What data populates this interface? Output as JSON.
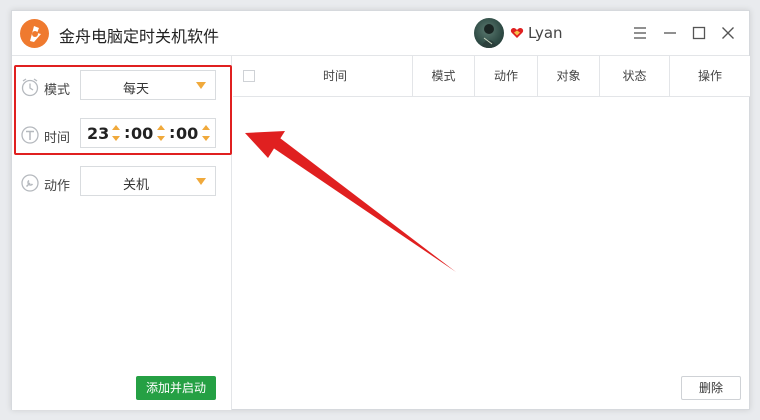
{
  "app": {
    "title": "金舟电脑定时关机软件",
    "accent": "#ef7a2f"
  },
  "user": {
    "name": "Lyan",
    "vip_color": "#e02020"
  },
  "controls": {
    "mode": {
      "label": "模式",
      "value": "每天"
    },
    "time": {
      "label": "时间",
      "hour": "23",
      "minute": "00",
      "second": "00",
      "sep": ":"
    },
    "action": {
      "label": "动作",
      "value": "关机"
    },
    "add_button": "添加并启动"
  },
  "table": {
    "headers": [
      "时间",
      "模式",
      "动作",
      "对象",
      "状态",
      "操作"
    ]
  },
  "delete_button": "删除",
  "icons": {
    "logo": "app-logo-icon",
    "mode": "clock-icon",
    "time": "time-t-icon",
    "action": "wrench-icon",
    "vip": "vip-heart-icon"
  },
  "colors": {
    "green": "#25a044",
    "caret": "#f0a93b",
    "annotation": "#e02020"
  }
}
